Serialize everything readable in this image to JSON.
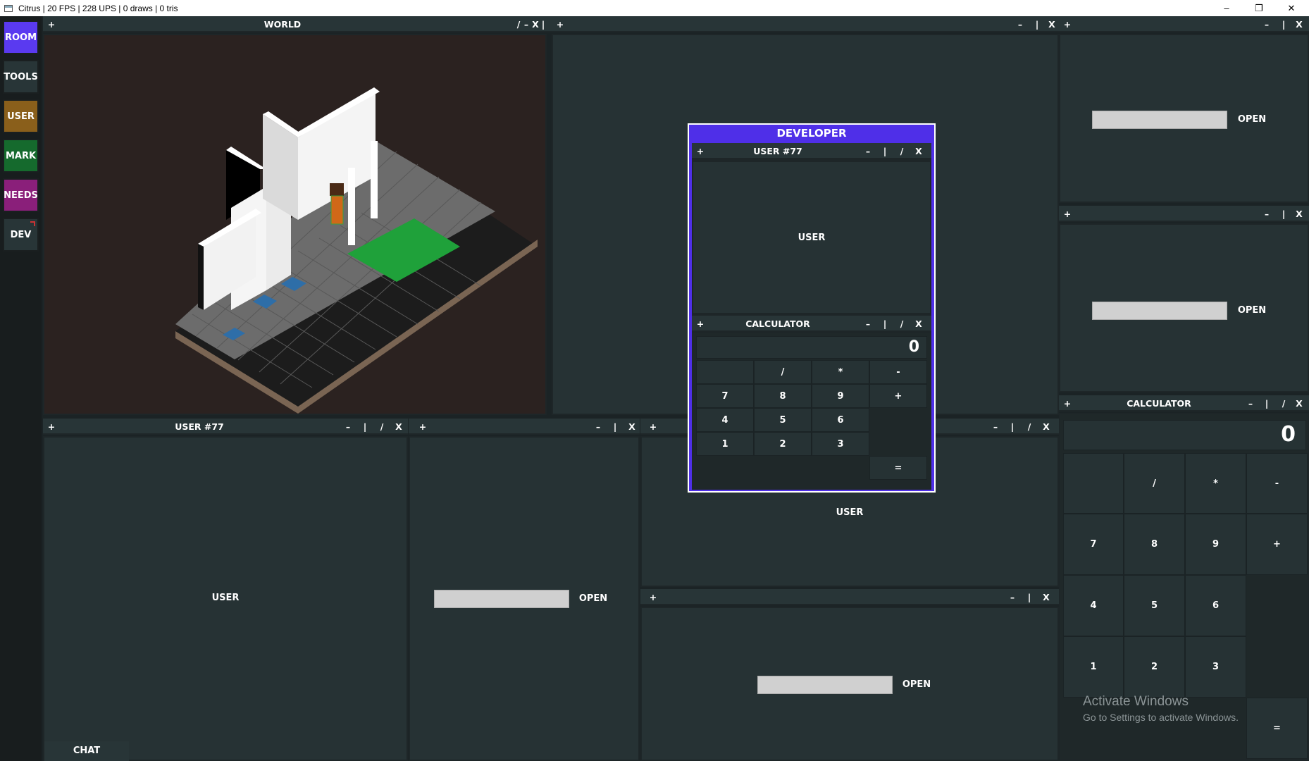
{
  "window": {
    "title": "Citrus | 20 FPS | 228 UPS | 0 draws | 0 tris",
    "minimize": "–",
    "restore": "❐",
    "close": "✕"
  },
  "sidebar": {
    "items": [
      {
        "label": "ROOM",
        "color": "#5a3af0"
      },
      {
        "label": "TOOLS",
        "color": "#283537"
      },
      {
        "label": "USER",
        "color": "#8a5f1b"
      },
      {
        "label": "MARK",
        "color": "#156a2d"
      },
      {
        "label": "NEEDS",
        "color": "#8a1f7a"
      },
      {
        "label": "DEV",
        "color": "#283537"
      }
    ]
  },
  "controls": {
    "add": "+",
    "min": "–",
    "split_v": "|",
    "split_d": "/",
    "close": "X"
  },
  "panels": {
    "world": {
      "title": "WORLD"
    },
    "user77": {
      "title": "USER #77",
      "content": "USER"
    },
    "user_mid": {
      "content": "USER"
    },
    "calc_right": {
      "title": "CALCULATOR"
    },
    "chat": {
      "label": "CHAT"
    },
    "open_label": "OPEN"
  },
  "calculator": {
    "display": "0",
    "keys": [
      "/",
      "*",
      "-",
      "7",
      "8",
      "9",
      "+",
      "4",
      "5",
      "6",
      "1",
      "2",
      "3",
      "="
    ]
  },
  "developer": {
    "title": "DEVELOPER",
    "user_panel_title": "USER #77",
    "user_content": "USER",
    "calc_title": "CALCULATOR"
  },
  "watermark": {
    "line1": "Activate Windows",
    "line2": "Go to Settings to activate Windows."
  },
  "colors": {
    "accent": "#5a3af0",
    "panel": "#263234",
    "panel_bar": "#283537",
    "grass": "#1fa13a"
  }
}
